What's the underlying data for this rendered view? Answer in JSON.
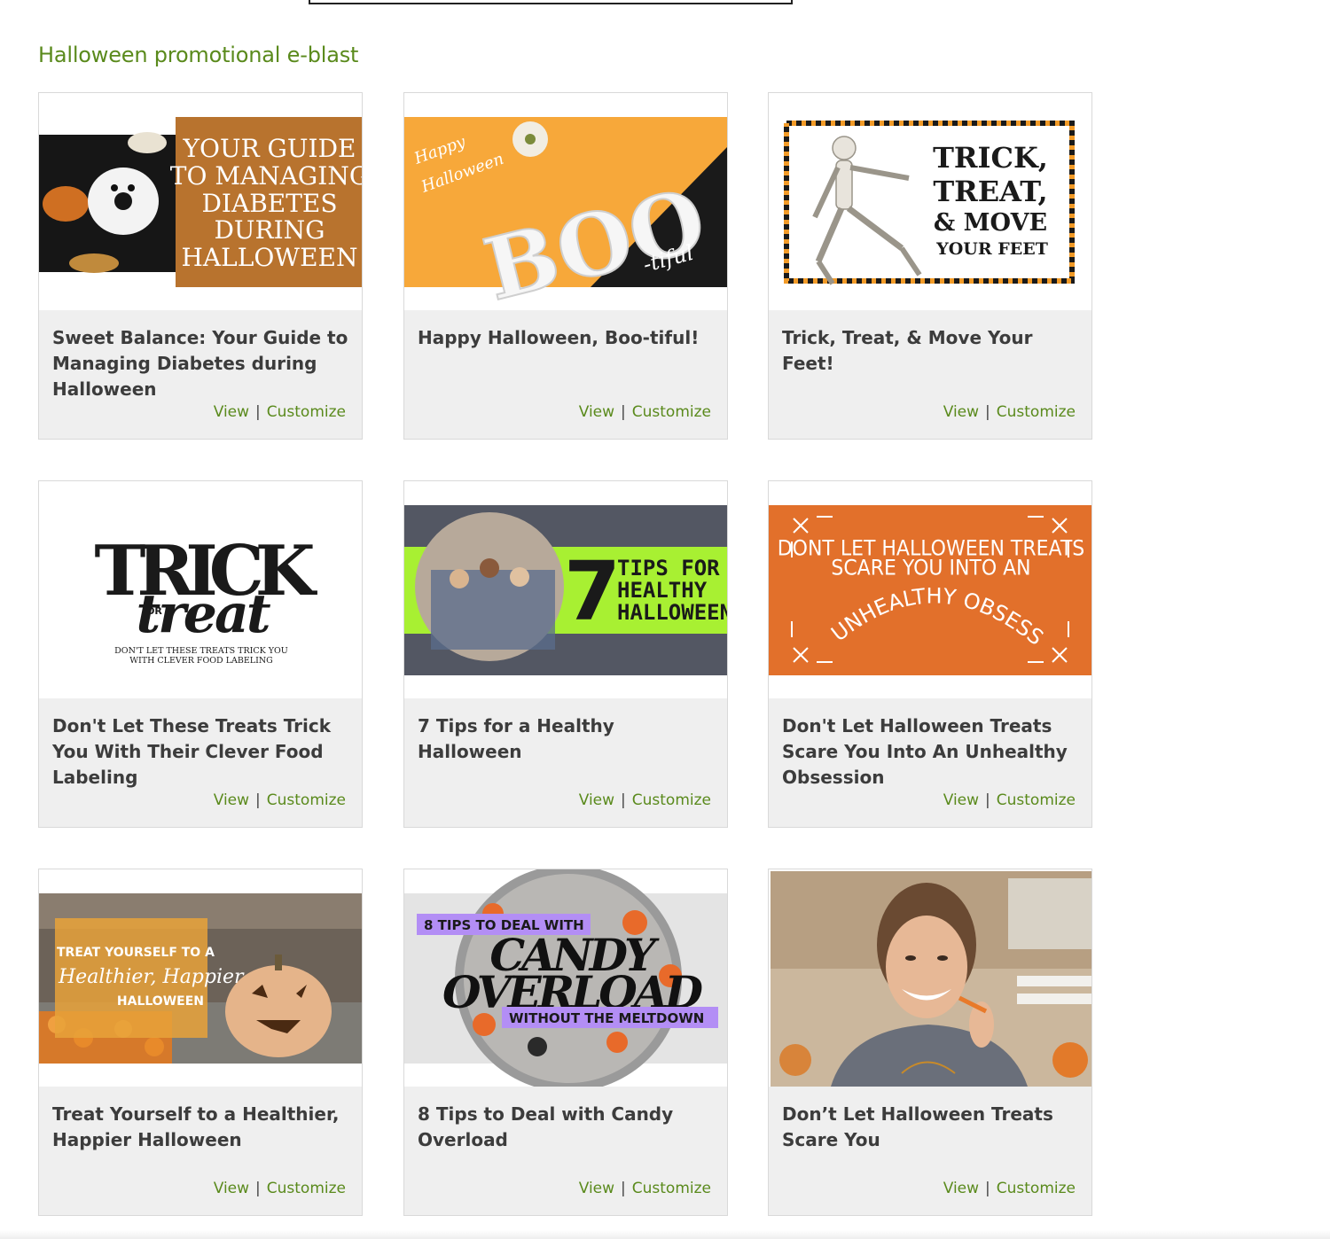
{
  "section": {
    "title": "Halloween promotional e-blast"
  },
  "link_color": "#5a8a1c",
  "cards": [
    {
      "title": "Sweet Balance: Your Guide to Managing Diabetes during Halloween",
      "view_label": "View",
      "customize_label": "Customize",
      "image": {
        "lines": [
          "YOUR GUIDE",
          "TO MANAGING",
          "DIABETES",
          "DURING",
          "HALLOWEEN"
        ],
        "accent": "#b8732e"
      }
    },
    {
      "title": "Happy Halloween, Boo-tiful!",
      "view_label": "View",
      "customize_label": "Customize",
      "image": {
        "script_1": "Happy",
        "script_2": "Halloween",
        "big": "BOO",
        "small": "-tiful",
        "accent": "#f7a83a"
      }
    },
    {
      "title": "Trick, Treat, & Move Your Feet!",
      "view_label": "View",
      "customize_label": "Customize",
      "image": {
        "lines": [
          "TRICK,",
          "TREAT,",
          "& MOVE",
          "YOUR FEET"
        ]
      }
    },
    {
      "title": "Don't Let These Treats Trick You With Their Clever Food Labeling",
      "view_label": "View",
      "customize_label": "Customize",
      "image": {
        "big_1": "TRICK",
        "or": "OR",
        "big_2": "treat",
        "caption_1": "DON'T LET THESE TREATS TRICK YOU",
        "caption_2": "WITH CLEVER FOOD LABELING"
      }
    },
    {
      "title": "7 Tips for a Healthy Halloween",
      "view_label": "View",
      "customize_label": "Customize",
      "image": {
        "number": "7",
        "lines": [
          "TIPS FOR A",
          "HEALTHY",
          "HALLOWEEN"
        ],
        "accent": "#a8f032"
      }
    },
    {
      "title": "Don't Let Halloween Treats Scare You Into An Unhealthy Obsession",
      "view_label": "View",
      "customize_label": "Customize",
      "image": {
        "lines": [
          "DONT LET HALLOWEEN TREATS",
          "SCARE YOU INTO AN"
        ],
        "curved": "UNHEALTHY OBSESSION",
        "accent": "#e2702b"
      }
    },
    {
      "title": "Treat Yourself to a Healthier, Happier Halloween",
      "view_label": "View",
      "customize_label": "Customize",
      "image": {
        "line_1": "TREAT YOURSELF TO A",
        "line_2": "Healthier, Happier",
        "line_3": "HALLOWEEN"
      }
    },
    {
      "title": "8 Tips to Deal with Candy Overload",
      "view_label": "View",
      "customize_label": "Customize",
      "image": {
        "tag_1": "8 TIPS TO DEAL WITH",
        "big_1": "CANDY",
        "big_2": "OVERLOAD",
        "tag_2": "WITHOUT THE MELTDOWN",
        "accent": "#b38ef5"
      }
    },
    {
      "title": "Don’t Let Halloween Treats Scare You",
      "view_label": "View",
      "customize_label": "Customize",
      "image": {}
    }
  ]
}
